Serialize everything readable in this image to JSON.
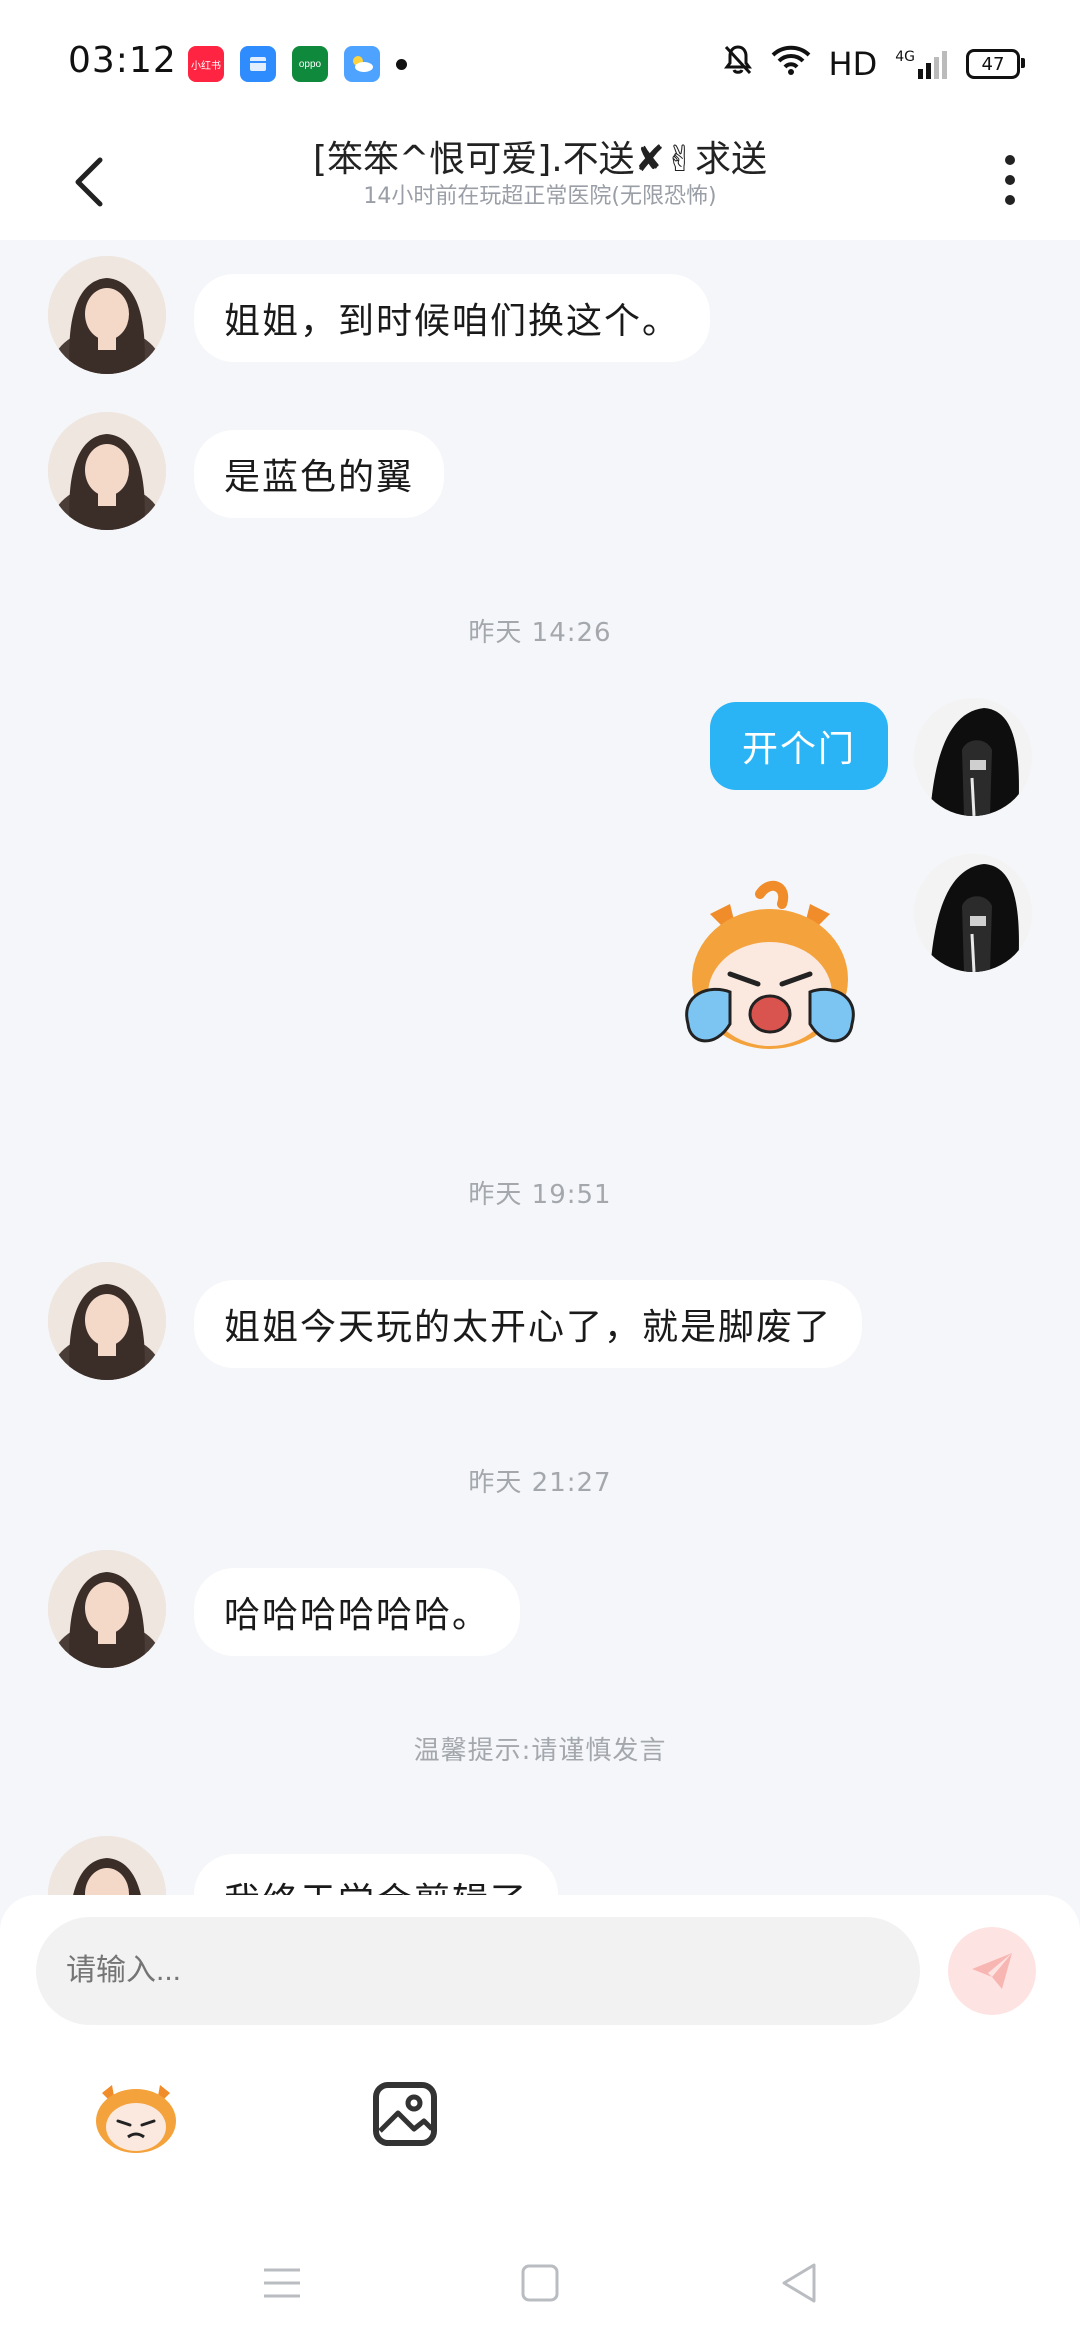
{
  "status_bar": {
    "time": "03:12",
    "apps": [
      {
        "name": "xiaohongshu-app-icon",
        "label": "小红书",
        "color": "#ff2442"
      },
      {
        "name": "files-app-icon",
        "label": "",
        "color": "#2f8cff"
      },
      {
        "name": "oppo-store-app-icon",
        "label": "oppo",
        "color": "#0f8a3c"
      },
      {
        "name": "weather-app-icon",
        "label": "",
        "color": "#4da3ff"
      }
    ],
    "network": "HD",
    "signal_type": "4G",
    "battery": "47"
  },
  "header": {
    "title": "[笨笨^恨可爱].不送✘✌求送",
    "subtitle": "14小时前在玩超正常医院(无限恐怖)"
  },
  "messages": [
    {
      "kind": "incoming",
      "text": "姐姐，到时候咱们换这个。"
    },
    {
      "kind": "incoming",
      "text": "是蓝色的翼"
    },
    {
      "kind": "timestamp",
      "text": "昨天 14:26"
    },
    {
      "kind": "outgoing",
      "text": "开个门"
    },
    {
      "kind": "outgoing-sticker",
      "sticker": "crying-cat-sticker"
    },
    {
      "kind": "timestamp",
      "text": "昨天 19:51"
    },
    {
      "kind": "incoming",
      "text": "姐姐今天玩的太开心了，就是脚废了"
    },
    {
      "kind": "timestamp",
      "text": "昨天 21:27"
    },
    {
      "kind": "incoming",
      "text": "哈哈哈哈哈哈。"
    },
    {
      "kind": "notice",
      "text": "温馨提示:请谨慎发言"
    },
    {
      "kind": "incoming",
      "text": "我终于学会剪辑了"
    }
  ],
  "input": {
    "placeholder": "请输入..."
  },
  "colors": {
    "accent": "#2ab3f5",
    "send_button": "#fde4e3",
    "background": "#f4f6f9"
  }
}
